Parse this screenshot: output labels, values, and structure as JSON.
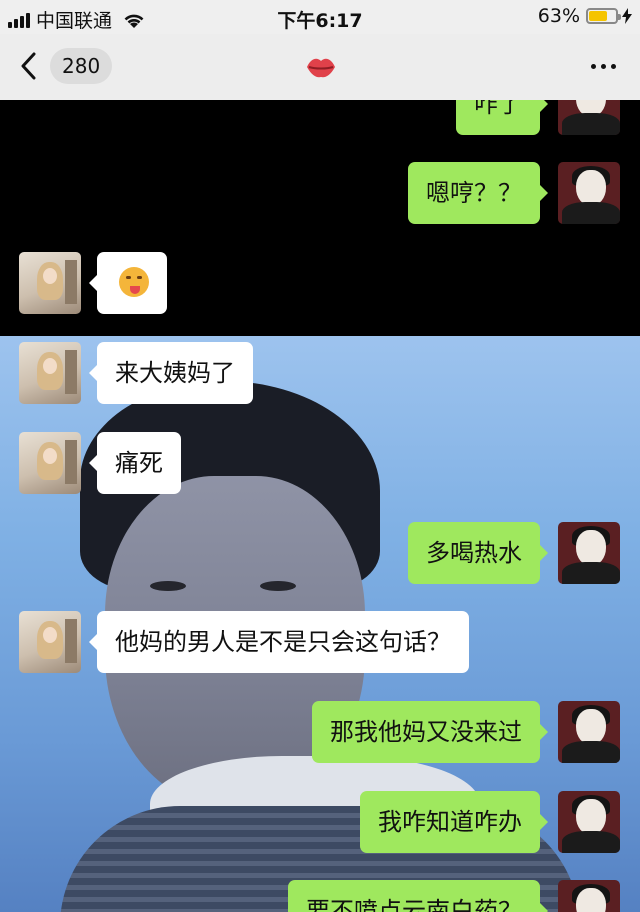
{
  "status_bar": {
    "carrier": "中国联通",
    "time": "下午6:17",
    "battery": "63%",
    "battery_level": 0.63
  },
  "nav": {
    "unread_count": "280",
    "title_icon": "kiss-lips-icon",
    "more_icon": "more-dots-icon"
  },
  "messages": [
    {
      "side": "right",
      "text": "咋了",
      "partial": true
    },
    {
      "side": "right",
      "text": "嗯哼？？"
    },
    {
      "side": "left",
      "emoji": "tongue-out-emoji"
    },
    {
      "side": "left",
      "text": "来大姨妈了"
    },
    {
      "side": "left",
      "text": "痛死"
    },
    {
      "side": "right",
      "text": "多喝热水"
    },
    {
      "side": "left",
      "text": "他妈的男人是不是只会这句话？"
    },
    {
      "side": "right",
      "text": "那我他妈又没来过"
    },
    {
      "side": "right",
      "text": "我咋知道咋办"
    },
    {
      "side": "right",
      "text": "要不喷点云南白药？",
      "partial": true
    }
  ],
  "colors": {
    "outgoing_bubble": "#9fe85e",
    "incoming_bubble": "#ffffff",
    "bar_background": "#ededed"
  }
}
